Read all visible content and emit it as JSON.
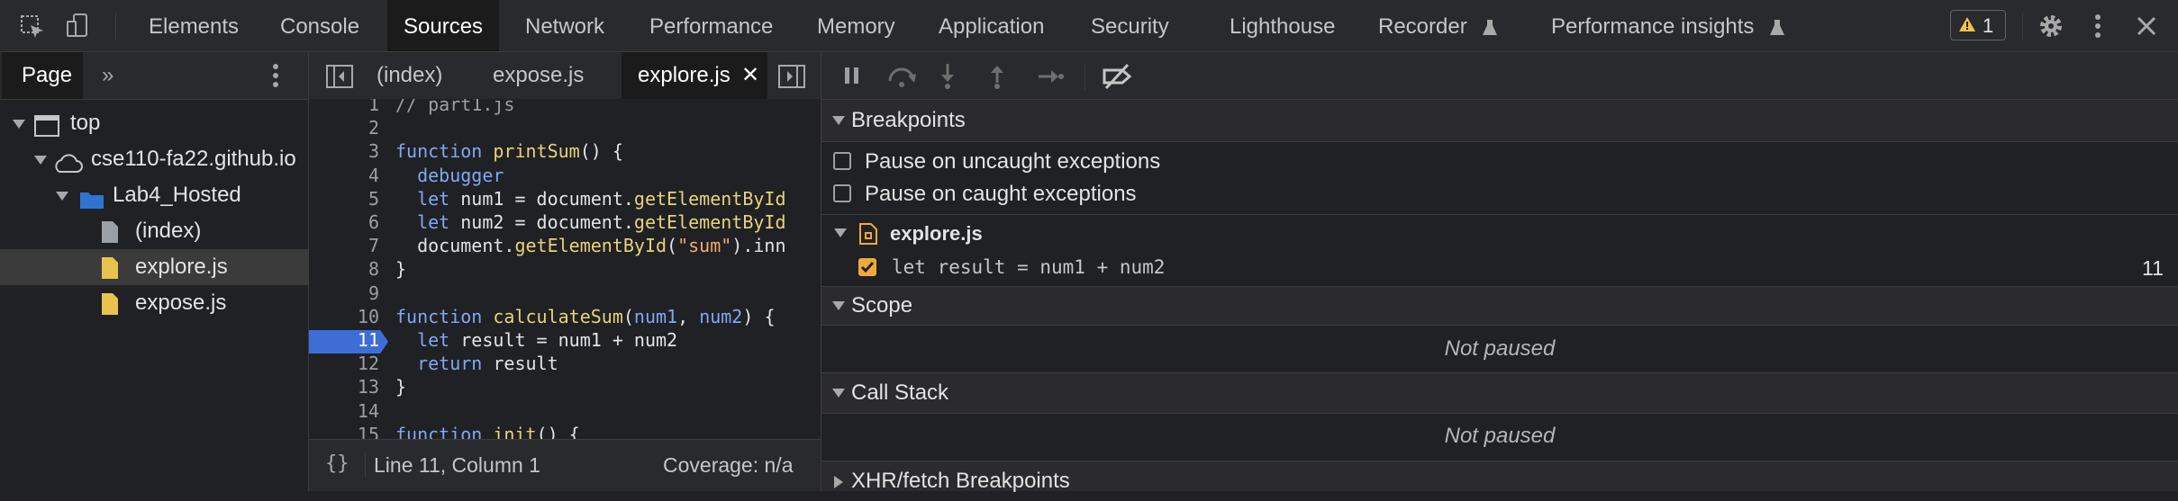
{
  "toolbar": {
    "tabs": [
      "Elements",
      "Console",
      "Sources",
      "Network",
      "Performance",
      "Memory",
      "Application",
      "Security",
      "Lighthouse",
      "Recorder",
      "Performance insights"
    ],
    "active_tab": "Sources",
    "warning_count": "1",
    "warning_color": "#f0c14b"
  },
  "navigator": {
    "tabs": [
      "Page"
    ],
    "tree": [
      {
        "label": "top",
        "icon": "window-icon"
      },
      {
        "label": "cse110-fa22.github.io",
        "icon": "cloud-icon"
      },
      {
        "label": "Lab4_Hosted",
        "icon": "folder-icon"
      },
      {
        "label": "(index)",
        "icon": "file-icon"
      },
      {
        "label": "explore.js",
        "icon": "js-file-icon",
        "selected": true
      },
      {
        "label": "expose.js",
        "icon": "js-file-icon"
      }
    ]
  },
  "editor": {
    "tabs": [
      "(index)",
      "expose.js",
      "explore.js"
    ],
    "active_tab": "explore.js",
    "lines": [
      {
        "n": "1",
        "text": "// part1.js"
      },
      {
        "n": "2",
        "text": ""
      },
      {
        "n": "3",
        "text": "function printSum() {"
      },
      {
        "n": "4",
        "text": "  debugger"
      },
      {
        "n": "5",
        "text": "  let num1 = document.getElementById"
      },
      {
        "n": "6",
        "text": "  let num2 = document.getElementById"
      },
      {
        "n": "7",
        "text": "  document.getElementById(\"sum\").inn"
      },
      {
        "n": "8",
        "text": "}"
      },
      {
        "n": "9",
        "text": ""
      },
      {
        "n": "10",
        "text": "function calculateSum(num1, num2) {"
      },
      {
        "n": "11",
        "text": "  let result = num1 + num2"
      },
      {
        "n": "12",
        "text": "  return result"
      },
      {
        "n": "13",
        "text": "}"
      },
      {
        "n": "14",
        "text": ""
      },
      {
        "n": "15",
        "text": "function init() {"
      }
    ],
    "breakpoint_line": "11",
    "status": {
      "format_icon": "{}",
      "position": "Line 11, Column 1",
      "coverage": "Coverage: n/a"
    }
  },
  "debugger": {
    "breakpoints_title": "Breakpoints",
    "pause_uncaught": "Pause on uncaught exceptions",
    "pause_caught": "Pause on caught exceptions",
    "bp_file": "explore.js",
    "bp_code": "let result = num1 + num2",
    "bp_line": "11",
    "scope_title": "Scope",
    "scope_status": "Not paused",
    "callstack_title": "Call Stack",
    "callstack_status": "Not paused",
    "xhr_title": "XHR/fetch Breakpoints",
    "accent_color": "#f0a93b"
  }
}
